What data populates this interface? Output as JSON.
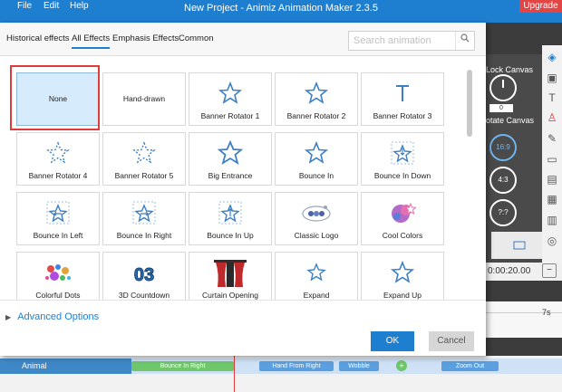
{
  "app": {
    "title": "New Project - Animiz Animation Maker 2.3.5",
    "menu": [
      "File",
      "Edit",
      "Help"
    ],
    "upgrade_label": "Upgrade"
  },
  "right_panel": {
    "lock_canvas": "Lock Canvas",
    "rotate_canvas": "otate Canvas",
    "rotate_value": "0",
    "aspect_169": "16:9",
    "aspect_43": "4:3",
    "aspect_custom": "?:?",
    "timecode": "0:00:20.00",
    "ruler_mark": "7s"
  },
  "timeline": {
    "layer_name": "Animal",
    "clips": [
      "Bounce In Right",
      "Hand From Right",
      "Wobble",
      "Zoom Out"
    ]
  },
  "dialog": {
    "tabs": [
      "Historical effects",
      "All Effects",
      "Emphasis Effects",
      "Common"
    ],
    "active_tab": "All Effects",
    "search_placeholder": "Search animation",
    "effects": [
      "None",
      "Hand-drawn",
      "Banner Rotator 1",
      "Banner Rotator 2",
      "Banner Rotator 3",
      "Banner Rotator 4",
      "Banner Rotator 5",
      "Big Entrance",
      "Bounce In",
      "Bounce In Down",
      "Bounce In Left",
      "Bounce In Right",
      "Bounce In Up",
      "Classic Logo",
      "Cool Colors",
      "Colorful Dots",
      "3D Countdown",
      "Curtain Opening",
      "Expand",
      "Expand Up"
    ],
    "selected_effect": "None",
    "advanced_options": "Advanced Options",
    "ok_label": "OK",
    "cancel_label": "Cancel"
  },
  "colors": {
    "accent": "#1e7fd1",
    "selected_tile": "#d6ebfb",
    "highlight_box": "#e03b3b",
    "upgrade": "#e34444"
  }
}
